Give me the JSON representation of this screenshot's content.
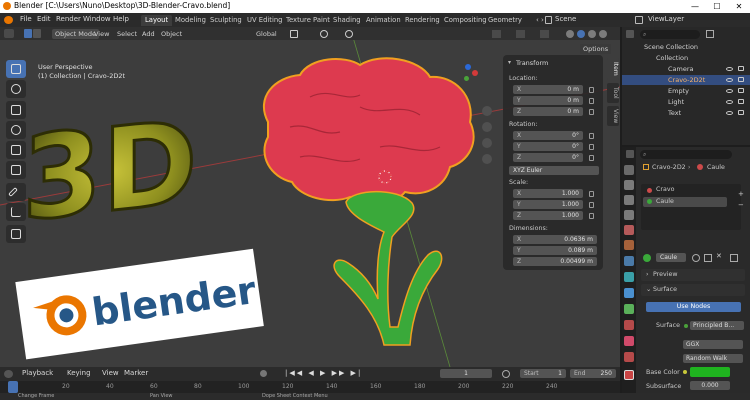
{
  "window": {
    "title": "Blender [C:\\Users\\Nuno\\Desktop\\3D-Blender-Cravo.blend]",
    "minimize": "—",
    "maximize": "☐",
    "close": "✕"
  },
  "menu": [
    "File",
    "Edit",
    "Render",
    "Window",
    "Help"
  ],
  "workspaces": [
    "Layout",
    "Modeling",
    "Sculpting",
    "UV Editing",
    "Texture Paint",
    "Shading",
    "Animation",
    "Rendering",
    "Compositing",
    "Geometry Noc"
  ],
  "scene": "Scene",
  "view_layer": "ViewLayer",
  "viewport_header": {
    "mode": "Object Mode",
    "items": [
      "View",
      "Select",
      "Add",
      "Object"
    ],
    "transform_orientation": "Global",
    "options": "Options"
  },
  "viewport_info": {
    "perspective": "User Perspective",
    "collection": "(1) Collection | Cravo-2D2t"
  },
  "scene_text": {
    "big_3d": "3D",
    "logo_word": "blender"
  },
  "npanel": {
    "title": "Transform",
    "location_label": "Location:",
    "location": [
      {
        "axis": "X",
        "value": "0 m"
      },
      {
        "axis": "Y",
        "value": "0 m"
      },
      {
        "axis": "Z",
        "value": "0 m"
      }
    ],
    "rotation_label": "Rotation:",
    "rotation": [
      {
        "axis": "X",
        "value": "0°"
      },
      {
        "axis": "Y",
        "value": "0°"
      },
      {
        "axis": "Z",
        "value": "0°"
      }
    ],
    "rotation_mode": "XYZ Euler",
    "scale_label": "Scale:",
    "scale": [
      {
        "axis": "X",
        "value": "1.000"
      },
      {
        "axis": "Y",
        "value": "1.000"
      },
      {
        "axis": "Z",
        "value": "1.000"
      }
    ],
    "dimensions_label": "Dimensions:",
    "dimensions": [
      {
        "axis": "X",
        "value": "0.0636 m"
      },
      {
        "axis": "Y",
        "value": "0.089 m"
      },
      {
        "axis": "Z",
        "value": "0.00499 m"
      }
    ],
    "tabs": [
      "Item",
      "Tool",
      "View"
    ]
  },
  "timeline": {
    "items": [
      "Playback",
      "Keying",
      "View",
      "Marker"
    ],
    "current_frame": "1",
    "start_label": "Start",
    "start": "1",
    "end_label": "End",
    "end": "250",
    "frame_ticks": [
      "20",
      "40",
      "60",
      "80",
      "100",
      "120",
      "140",
      "160",
      "180",
      "200",
      "220",
      "240"
    ]
  },
  "status": {
    "left": "Change Frame",
    "mid": "Pan View",
    "right": "Dope Sheet Context Menu"
  },
  "outliner": {
    "root": "Scene Collection",
    "collection": "Collection",
    "items": [
      {
        "name": "Camera",
        "selected": false
      },
      {
        "name": "Cravo-2D2t",
        "selected": true
      },
      {
        "name": "Empty",
        "selected": false
      },
      {
        "name": "Light",
        "selected": false
      },
      {
        "name": "Text",
        "selected": false
      }
    ]
  },
  "properties": {
    "object_name": "Cravo-2D2",
    "material_name": "Caule",
    "slots": [
      "Cravo",
      "Caule"
    ],
    "material_field": "Caule",
    "preview_label": "Preview",
    "surface_label": "Surface",
    "use_nodes": "Use Nodes",
    "surface_field_label": "Surface",
    "surface_value": "Principled B...",
    "distribution": "GGX",
    "subsurface_method": "Random Walk",
    "base_color_label": "Base Color",
    "base_color": "#1fb31f",
    "subsurface_label": "Subsurface",
    "subsurface_value": "0.000"
  },
  "colors": {
    "accent": "#4772b3",
    "selection": "#334d80",
    "flower": "#dd3a4f",
    "stem": "#3aa93a",
    "outline": "#f0a020"
  }
}
